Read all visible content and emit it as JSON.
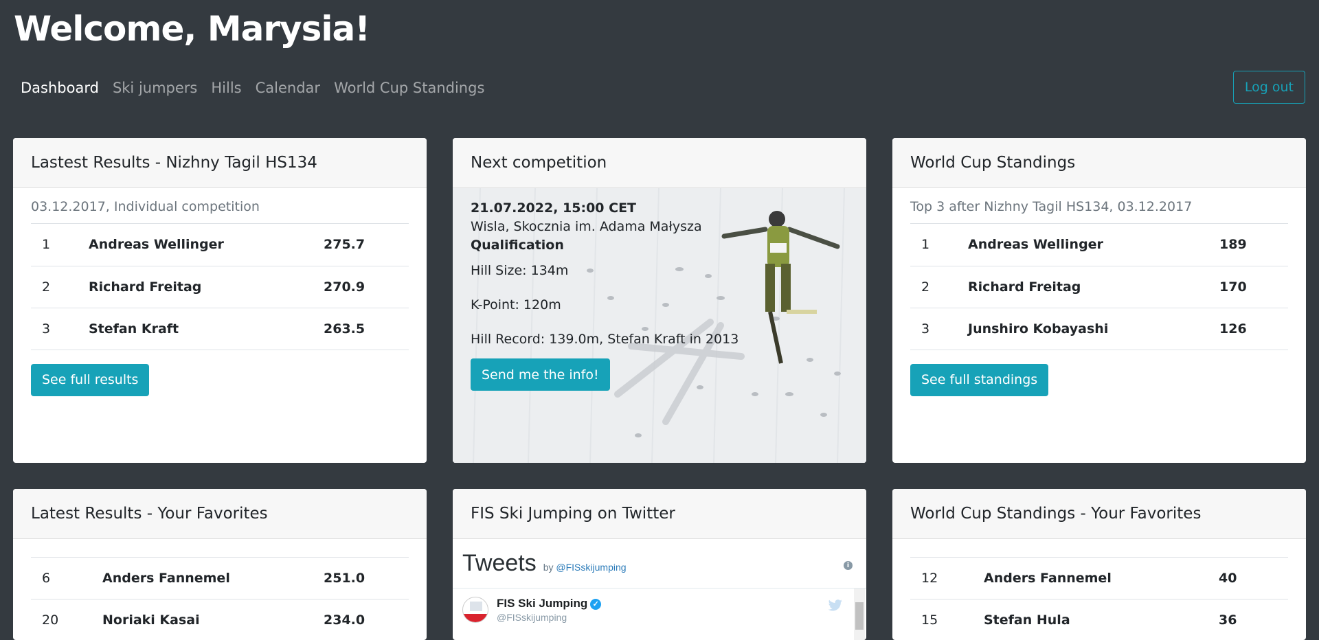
{
  "header": {
    "welcome": "Welcome, Marysia!",
    "logout_label": "Log out"
  },
  "nav": {
    "items": [
      {
        "label": "Dashboard",
        "active": true
      },
      {
        "label": "Ski jumpers",
        "active": false
      },
      {
        "label": "Hills",
        "active": false
      },
      {
        "label": "Calendar",
        "active": false
      },
      {
        "label": "World Cup Standings",
        "active": false
      }
    ]
  },
  "latest_results": {
    "title": "Lastest Results - Nizhny Tagil HS134",
    "subtitle": "03.12.2017, Individual competition",
    "rows": [
      {
        "rank": "1",
        "name": "Andreas Wellinger",
        "score": "275.7"
      },
      {
        "rank": "2",
        "name": "Richard Freitag",
        "score": "270.9"
      },
      {
        "rank": "3",
        "name": "Stefan Kraft",
        "score": "263.5"
      }
    ],
    "button_label": "See full results"
  },
  "next_competition": {
    "title": "Next competition",
    "datetime": "21.07.2022, 15:00 CET",
    "venue": "Wisla, Skocznia im. Adama Małysza",
    "type": "Qualification",
    "hill_size": "Hill Size: 134m",
    "k_point": "K-Point: 120m",
    "hill_record": "Hill Record: 139.0m, Stefan Kraft in 2013",
    "button_label": "Send me the info!"
  },
  "world_cup": {
    "title": "World Cup Standings",
    "subtitle": "Top 3 after Nizhny Tagil HS134, 03.12.2017",
    "rows": [
      {
        "rank": "1",
        "name": "Andreas Wellinger",
        "points": "189"
      },
      {
        "rank": "2",
        "name": "Richard Freitag",
        "points": "170"
      },
      {
        "rank": "3",
        "name": "Junshiro Kobayashi",
        "points": "126"
      }
    ],
    "button_label": "See full standings"
  },
  "fav_results": {
    "title": "Latest Results - Your Favorites",
    "rows": [
      {
        "rank": "6",
        "name": "Anders Fannemel",
        "score": "251.0"
      },
      {
        "rank": "20",
        "name": "Noriaki Kasai",
        "score": "234.0"
      }
    ]
  },
  "twitter": {
    "title": "FIS Ski Jumping on Twitter",
    "widget_title": "Tweets",
    "by_prefix": "by",
    "handle": "@FISskijumping",
    "account_name": "FIS Ski Jumping",
    "account_handle": "@FISskijumping"
  },
  "fav_standings": {
    "title": "World Cup Standings - Your Favorites",
    "rows": [
      {
        "rank": "12",
        "name": "Anders Fannemel",
        "points": "40"
      },
      {
        "rank": "15",
        "name": "Stefan Hula",
        "points": "36"
      }
    ]
  },
  "colors": {
    "background": "#343a40",
    "accent": "#17a2b8",
    "card_header": "#f7f7f7"
  }
}
